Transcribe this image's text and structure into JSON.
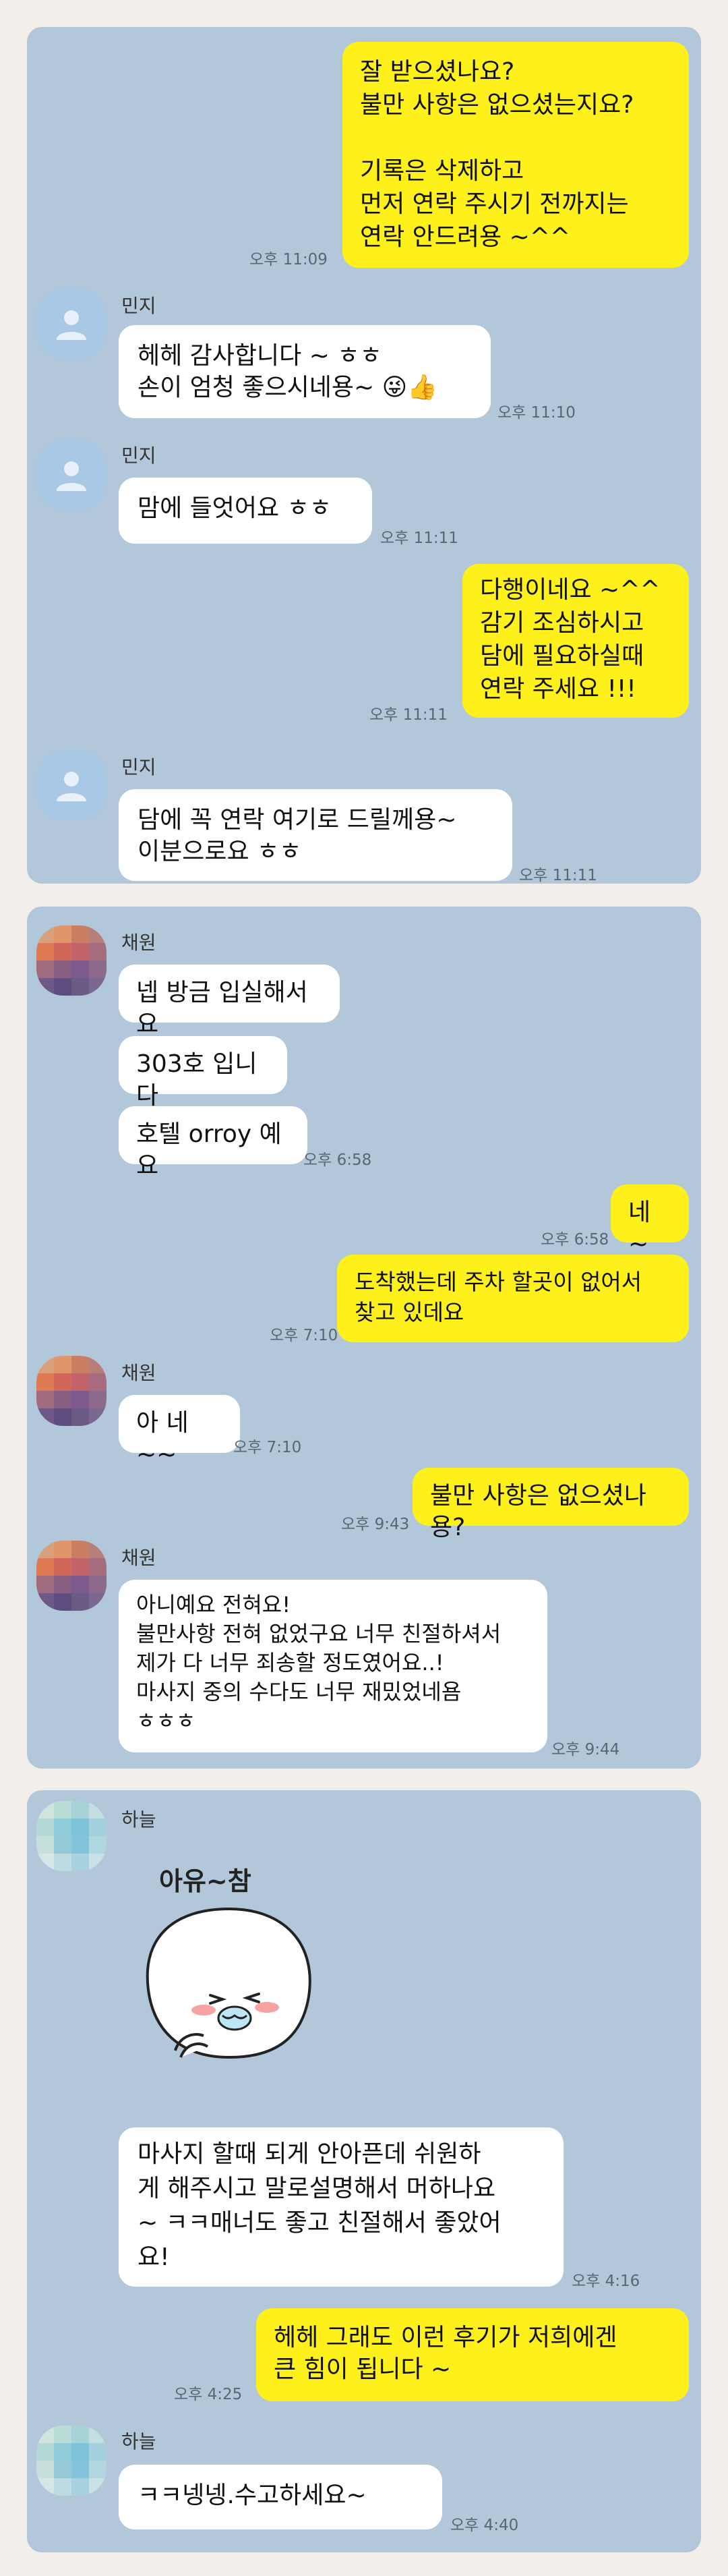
{
  "panel1": {
    "m1": "잘 받으셨나요?\n불만 사항은 없으셨는지요?\n\n기록은 삭제하고\n먼저 연락 주시기 전까지는\n연락 안드려용 ~^^",
    "t1": "오후 11:09",
    "name": "민지",
    "m2": "헤헤 감사합니다 ~ ㅎㅎ\n손이 엄청 좋으시네용~ 😜👍",
    "t2": "오후 11:10",
    "m3": "맘에 들엇어요 ㅎㅎ",
    "t3": "오후 11:11",
    "m4": "다행이네요 ~^^\n감기 조심하시고\n담에 필요하실때\n연락 주세요 !!!",
    "t4": "오후 11:11",
    "m5": "담에 꼭 연락 여기로 드릴께용~\n이분으로요 ㅎㅎ",
    "t5": "오후 11:11"
  },
  "panel2": {
    "name": "채원",
    "m1": "넵 방금 입실해서요",
    "m2": "303호 입니다",
    "m3": "호텔 orroy 예요",
    "t3": "오후 6:58",
    "m4": "네 ~",
    "t4": "오후 6:58",
    "m5": "도착했는데  주차 할곳이 없어서\n찾고 있데요",
    "t5": "오후 7:10",
    "m6": "아 네~~",
    "t6": "오후 7:10",
    "m7": "불만 사항은 없으셨나용?",
    "t7": "오후 9:43",
    "m8": "아니예요 전혀요!\n불만사항 전혀 없었구요 너무 친절하셔서\n제가 다 너무 죄송할 정도였어요..!\n마사지 중의 수다도 너무 재밌었네욤\nㅎㅎㅎ",
    "t8": "오후 9:44"
  },
  "panel3": {
    "name": "하늘",
    "sticker_text": "아유~참",
    "m1": "마사지 할때 되게 안아픈데 쉬원하\n게 해주시고 말로설명해서 머하나요\n~ ㅋㅋ매너도 좋고 친절해서 좋았어\n요!",
    "t1": "오후 4:16",
    "m2": "헤헤 그래도 이런 후기가 저희에겐\n큰 힘이 됩니다 ~",
    "t2": "오후 4:25",
    "m3": "ㅋㅋ넹넹.수고하세요~",
    "t3": "오후 4:40"
  },
  "colors": {
    "chat_bg": "#b2c7da",
    "my_bubble": "#fef01b",
    "other_bubble": "#ffffff",
    "page_bg": "#f2efea"
  }
}
